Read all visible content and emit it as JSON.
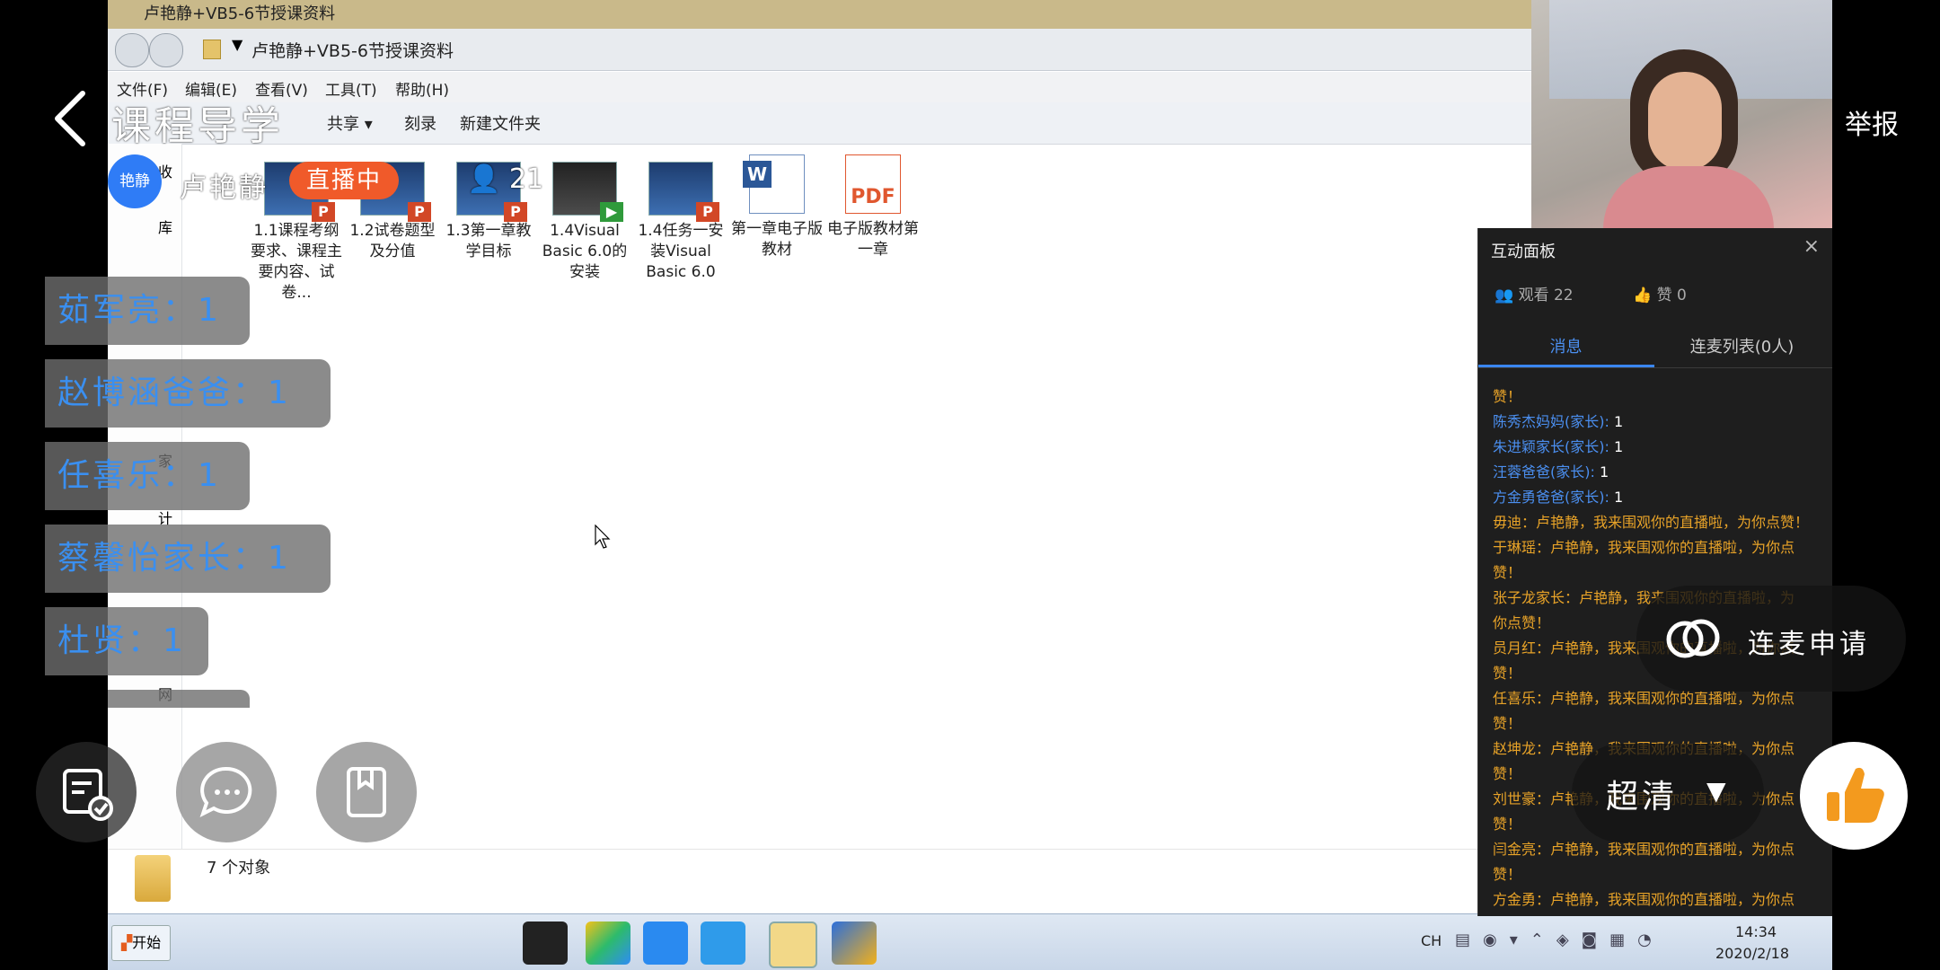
{
  "explorer": {
    "title": "卢艳静+VB5-6节授课资料",
    "address": "卢艳静+VB5-6节授课资料",
    "menu": [
      "文件(F)",
      "编辑(E)",
      "查看(V)",
      "工具(T)",
      "帮助(H)"
    ],
    "toolbar": [
      "共享",
      "刻录",
      "新建文件夹"
    ],
    "nav": [
      "收",
      "库",
      "家",
      "计",
      "网"
    ],
    "files": [
      {
        "name": "1.1课程考纲要求、课程主要内容、试卷...",
        "type": "ppt"
      },
      {
        "name": "1.2试卷题型及分值",
        "type": "ppt"
      },
      {
        "name": "1.3第一章教学目标",
        "type": "ppt"
      },
      {
        "name": "1.4Visual Basic 6.0的安装",
        "type": "video"
      },
      {
        "name": "1.4任务一安装Visual Basic 6.0",
        "type": "ppt"
      },
      {
        "name": "第一章电子版教材",
        "type": "word"
      },
      {
        "name": "电子版教材第一章",
        "type": "pdf"
      }
    ],
    "status": "7 个对象"
  },
  "taskbar": {
    "start": "开始",
    "lang": "CH",
    "time": "14:34",
    "date": "2020/2/18"
  },
  "panel": {
    "title": "互动面板",
    "close": "×",
    "views": "观看 22",
    "likes": "赞 0",
    "tab_msg": "消息",
    "tab_link": "连麦列表(0人)",
    "messages": [
      {
        "u": "",
        "c": "赞！",
        "v": ""
      },
      {
        "u": "陈秀杰妈妈(家长):",
        "c": "",
        "v": " 1"
      },
      {
        "u": "朱进颖家长(家长):",
        "c": "",
        "v": " 1"
      },
      {
        "u": "汪蓉爸爸(家长):",
        "c": "",
        "v": " 1"
      },
      {
        "u": "方金勇爸爸(家长):",
        "c": "",
        "v": " 1"
      },
      {
        "u": "",
        "c": "毋迪：卢艳静，我来围观你的直播啦，为你点赞！",
        "v": ""
      },
      {
        "u": "",
        "c": "于琳瑶：卢艳静，我来围观你的直播啦，为你点",
        "v": ""
      },
      {
        "u": "",
        "c": "赞！",
        "v": ""
      },
      {
        "u": "",
        "c": "张子龙家长：卢艳静，我来围观你的直播啦，为",
        "v": ""
      },
      {
        "u": "",
        "c": "你点赞！",
        "v": ""
      },
      {
        "u": "",
        "c": "员月红：卢艳静，我来围观你的直播啦，为你点",
        "v": ""
      },
      {
        "u": "",
        "c": "赞！",
        "v": ""
      },
      {
        "u": "",
        "c": "任喜乐：卢艳静，我来围观你的直播啦，为你点",
        "v": ""
      },
      {
        "u": "",
        "c": "赞！",
        "v": ""
      },
      {
        "u": "",
        "c": "赵坤龙：卢艳静，我来围观你的直播啦，为你点",
        "v": ""
      },
      {
        "u": "",
        "c": "赞！",
        "v": ""
      },
      {
        "u": "",
        "c": "刘世豪：卢艳静，我来围观你的直播啦，为你点",
        "v": ""
      },
      {
        "u": "",
        "c": "赞！",
        "v": ""
      },
      {
        "u": "",
        "c": "闫金亮：卢艳静，我来围观你的直播啦，为你点",
        "v": ""
      },
      {
        "u": "",
        "c": "赞！",
        "v": ""
      },
      {
        "u": "",
        "c": "方金勇：卢艳静，我来围观你的直播啦，为你点",
        "v": ""
      }
    ]
  },
  "overlay": {
    "back_icon": "chevron-left-icon",
    "title": "课程导学",
    "report": "举报",
    "host_avatar_text": "艳静",
    "host_name": "卢艳静",
    "live_badge": "直播中",
    "viewer_count": "21",
    "danmu": [
      "茹军亮：1",
      "赵博涵爸爸：1",
      "任喜乐：1",
      "蔡馨怡家长：1",
      "杜贤：1"
    ],
    "link_mic": "连麦申请",
    "quality": "超清",
    "colors": {
      "live_badge": "#f05a2a",
      "avatar": "#2f7cf6",
      "danmu_text": "#3a8ff0",
      "like_button": "#f39a1e"
    }
  }
}
